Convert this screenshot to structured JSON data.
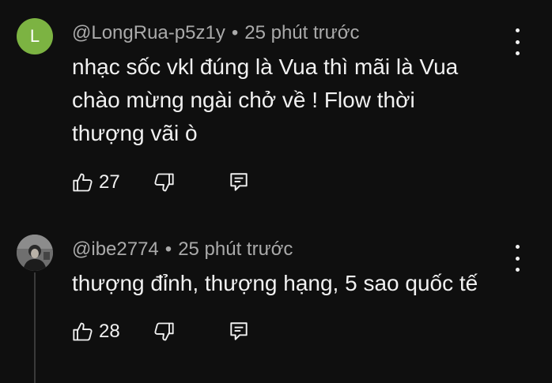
{
  "comments": [
    {
      "avatar_letter": "L",
      "avatar_color": "#7cb342",
      "author": "@LongRua-p5z1y",
      "separator": "•",
      "time": "25 phút trước",
      "text_lines": [
        "nhạc sốc vkl đúng là Vua thì mãi là Vua",
        "chào mừng ngài chở về ! Flow thời",
        "thượng vãi ò"
      ],
      "like_count": "27"
    },
    {
      "avatar_kind": "photo",
      "author": "@ibe2774",
      "separator": "•",
      "time": "25 phút trước",
      "text_lines": [
        "thượng đỉnh, thượng hạng, 5 sao quốc tế"
      ],
      "like_count": "28"
    }
  ],
  "icons": {
    "like": "thumbs-up-icon",
    "dislike": "thumbs-down-icon",
    "reply": "reply-comment-icon",
    "more": "more-vertical-icon"
  }
}
